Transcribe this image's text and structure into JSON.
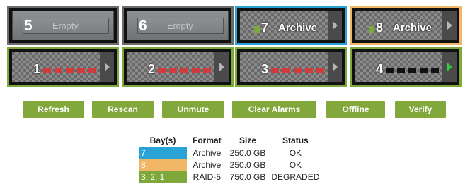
{
  "bays": {
    "b5": {
      "number": "5",
      "label": "Empty"
    },
    "b6": {
      "number": "6",
      "label": "Empty"
    },
    "b7": {
      "number": "7",
      "label": "Archive"
    },
    "b8": {
      "number": "8",
      "label": "Archive"
    },
    "b1": {
      "number": "1"
    },
    "b2": {
      "number": "2"
    },
    "b3": {
      "number": "3"
    },
    "b4": {
      "number": "4"
    }
  },
  "buttons": {
    "refresh": "Refresh",
    "rescan": "Rescan",
    "unmute": "Unmute",
    "clear_alarms": "Clear Alarms",
    "offline": "Offline",
    "verify": "Verify"
  },
  "legend": {
    "headers": {
      "bays": "Bay(s)",
      "format": "Format",
      "size": "Size",
      "status": "Status"
    },
    "rows": [
      {
        "bays": "7",
        "format": "Archive",
        "size": "250.0 GB",
        "status": "OK",
        "color": "#29a3d6"
      },
      {
        "bays": "8",
        "format": "Archive",
        "size": "250.0 GB",
        "status": "OK",
        "color": "#f2b766"
      },
      {
        "bays": "3, 2, 1",
        "format": "RAID-5",
        "size": "750.0 GB",
        "status": "DEGRADED",
        "color": "#7fa83a"
      }
    ]
  },
  "colors": {
    "bay7_border": "#29a3d6",
    "bay8_border": "#f2b766",
    "raid_border": "#7fa83a",
    "button_green": "#82a73a",
    "segment_red": "#d13b3b",
    "play_green": "#2ecc40"
  }
}
